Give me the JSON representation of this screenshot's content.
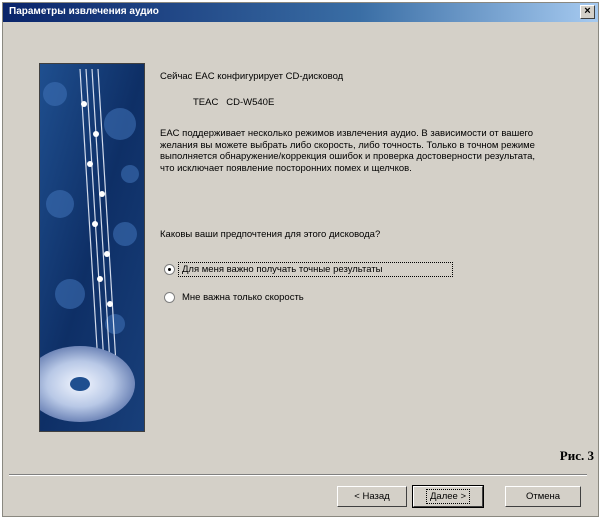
{
  "window": {
    "title": "Параметры извлечения аудио",
    "close_label": "×"
  },
  "content": {
    "configuring_text": "Сейчас EAC конфигурирует CD-дисковод",
    "drive_name": "TEAC   CD-W540E",
    "description": "EAC поддерживает несколько режимов извлечения аудио. В зависимости от вашего желания вы можете выбрать либо скорость, либо точность. Только в точном режиме выполняется обнаружение/коррекция ошибок и проверка достоверности результата, что исключает появление посторонних помех и щелчков.",
    "question": "Каковы ваши предпочтения для этого дисковода?",
    "options": [
      {
        "label": "Для меня важно получать точные результаты",
        "selected": true
      },
      {
        "label": "Мне важна только скорость",
        "selected": false
      }
    ]
  },
  "caption": "Рис. 3",
  "buttons": {
    "back": "< Назад",
    "next": "Далее >",
    "cancel": "Отмена"
  }
}
